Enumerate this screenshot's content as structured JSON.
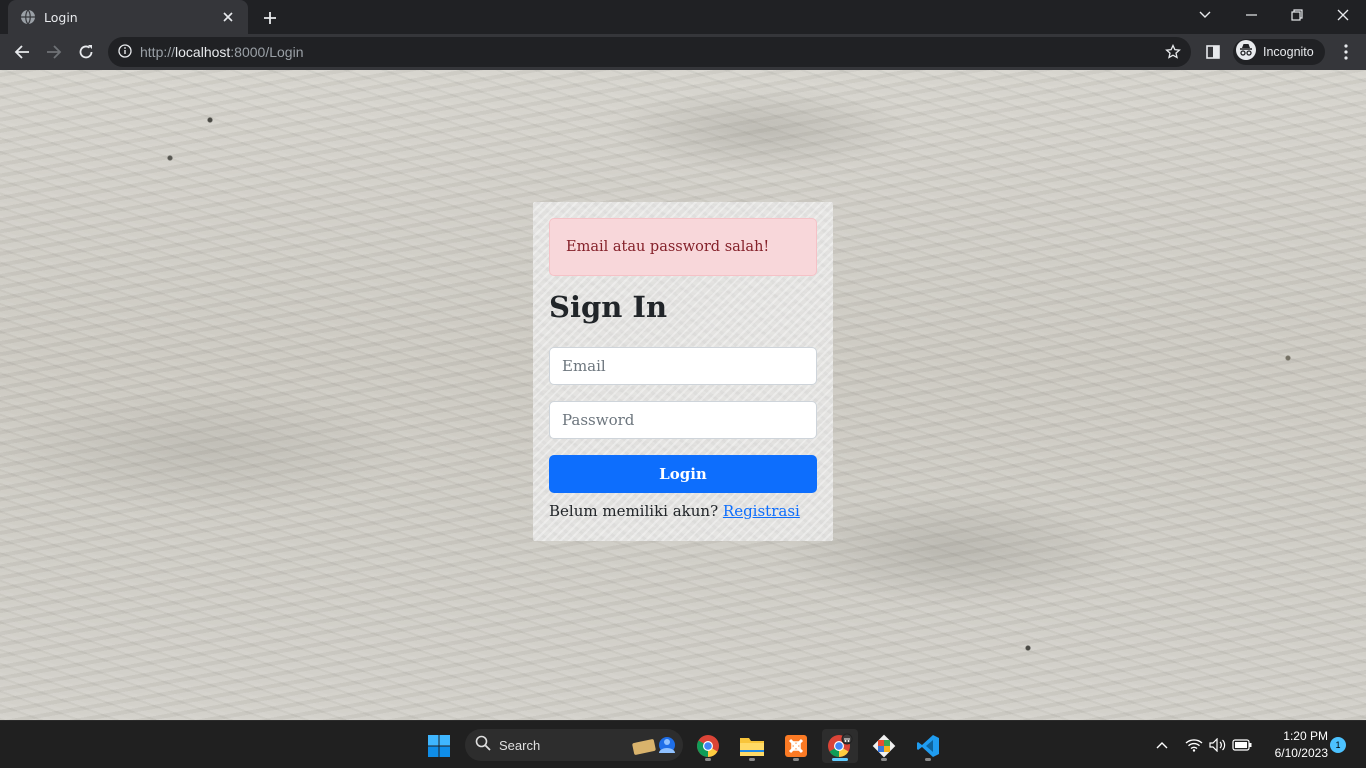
{
  "browser": {
    "tab_title": "Login",
    "url_prefix": "http://",
    "url_host": "localhost",
    "url_path": ":8000/Login",
    "profile_label": "Incognito"
  },
  "page": {
    "alert_text": "Email atau password salah!",
    "heading": "Sign In",
    "email_placeholder": "Email",
    "password_placeholder": "Password",
    "login_button": "Login",
    "register_prompt": "Belum memiliki akun?",
    "register_link": "Registrasi"
  },
  "taskbar": {
    "search_label": "Search",
    "time": "1:20 PM",
    "date": "6/10/2023",
    "notification_count": "1"
  },
  "colors": {
    "primary": "#0d6efd",
    "alert_bg": "#f8d7da",
    "alert_text": "#842029",
    "browser_frame": "#202124"
  },
  "icons": [
    "globe-icon",
    "close-icon",
    "plus-icon",
    "back-icon",
    "forward-icon",
    "reload-icon",
    "info-icon",
    "star-icon",
    "sidepanel-icon",
    "incognito-icon",
    "windows-start-icon",
    "search-icon",
    "chrome-icon",
    "file-explorer-icon",
    "xampp-icon",
    "git-icon",
    "vscode-icon",
    "wifi-icon",
    "volume-icon",
    "battery-icon"
  ]
}
